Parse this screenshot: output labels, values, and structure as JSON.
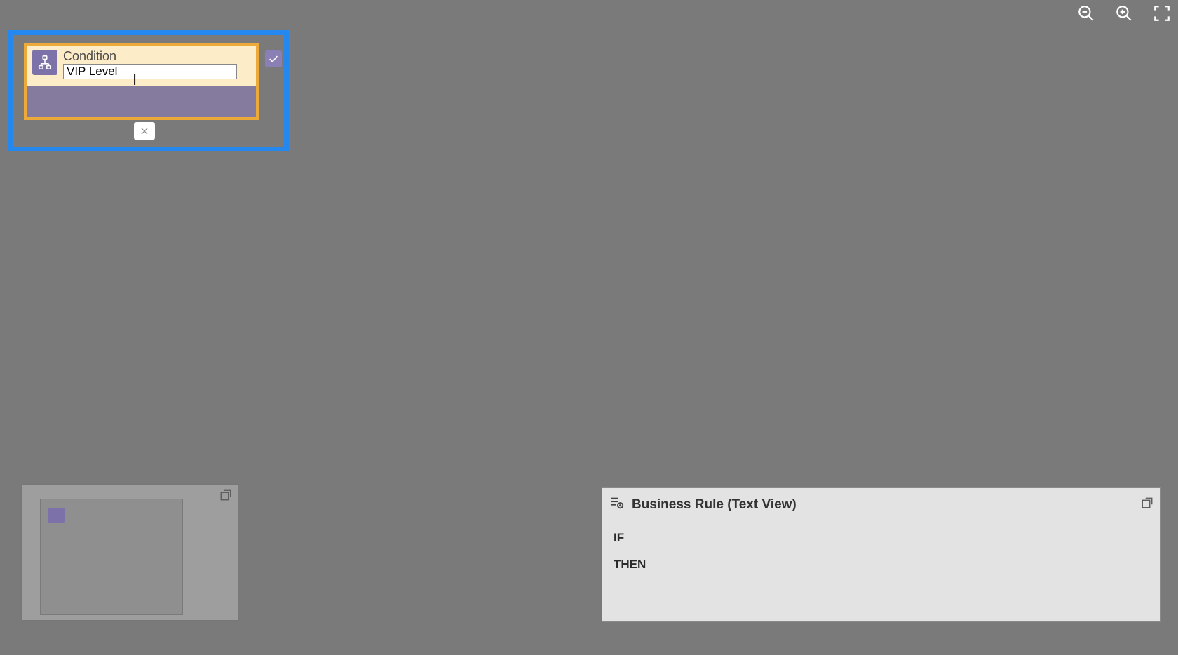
{
  "toolbar": {
    "zoom_out": "zoom-out",
    "zoom_in": "zoom-in",
    "fit": "fit-to-screen"
  },
  "condition": {
    "label": "Condition",
    "name_value": "VIP Level",
    "confirm": "ok",
    "branch_false": "x"
  },
  "minimap": {
    "popout": "expand"
  },
  "textview": {
    "title": "Business Rule (Text View)",
    "if": "IF",
    "then": "THEN",
    "popout": "expand"
  }
}
